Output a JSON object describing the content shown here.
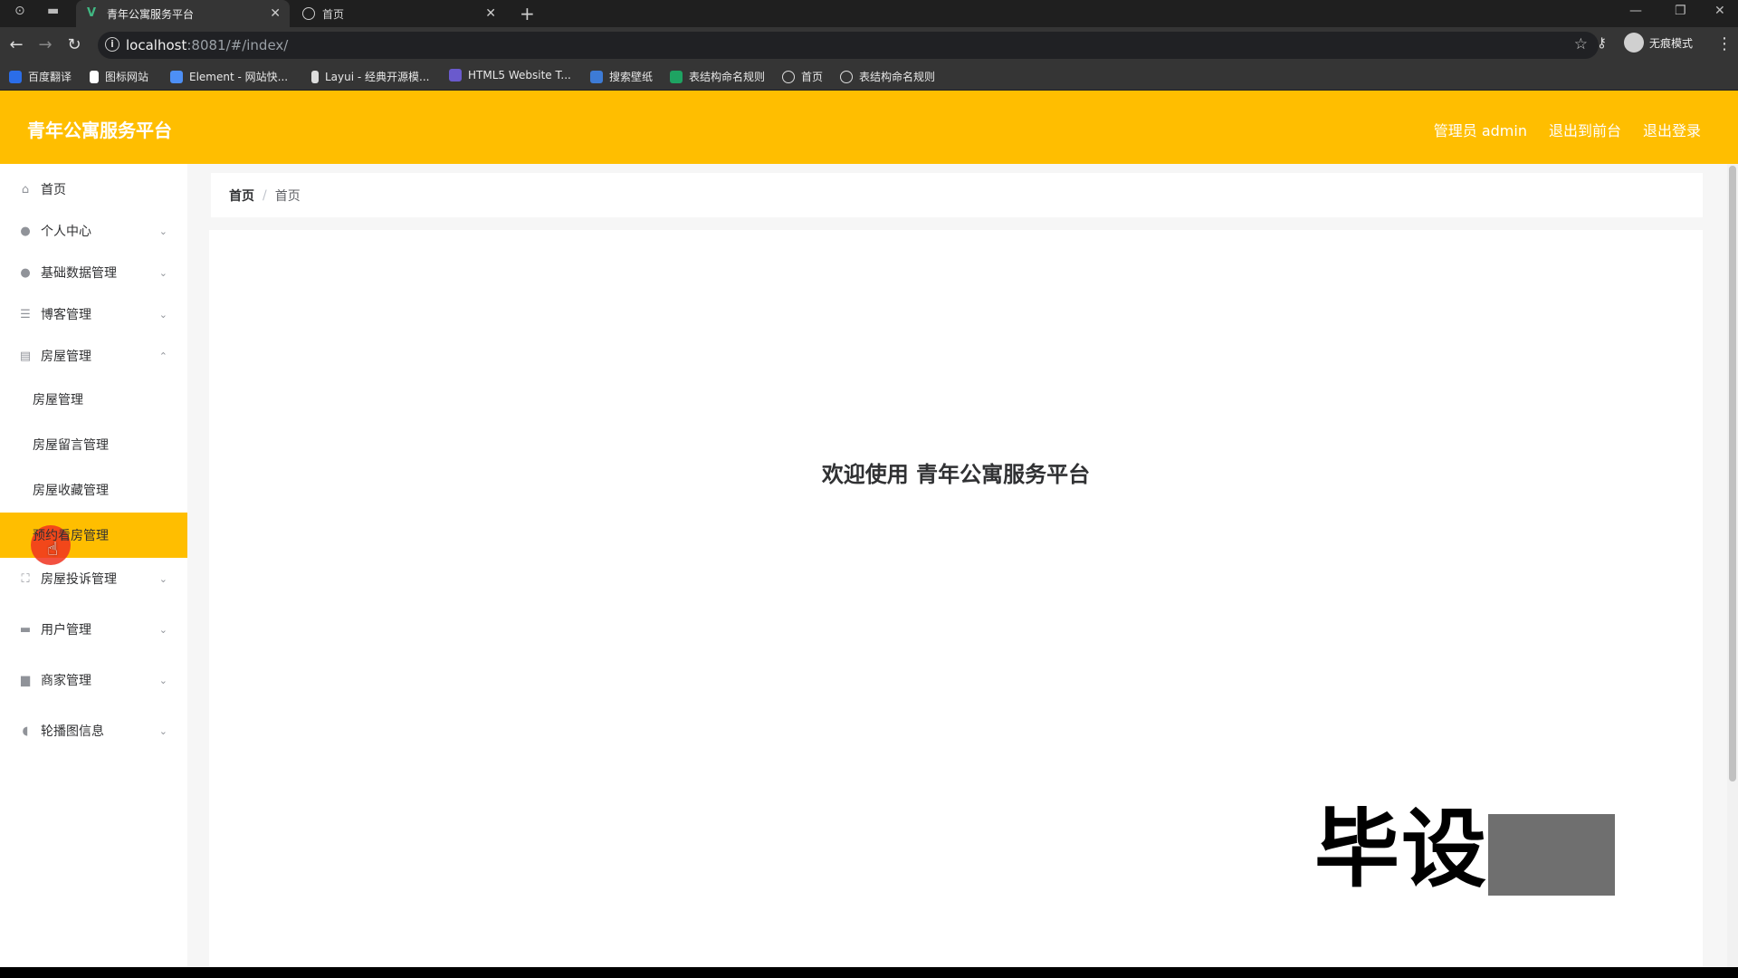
{
  "browser": {
    "tabs": [
      {
        "title": "青年公寓服务平台",
        "active": true
      },
      {
        "title": "首页",
        "active": false
      }
    ],
    "url_host": "localhost",
    "url_rest": ":8081/#/index/",
    "incognito_label": "无痕模式",
    "bookmarks": [
      {
        "label": "百度翻译",
        "color": "#2b6de8"
      },
      {
        "label": "图标网站",
        "color": "#ffffff"
      },
      {
        "label": "Element - 网站快...",
        "color": "#4d8ff5"
      },
      {
        "label": "Layui - 经典开源模...",
        "color": "#ffffff"
      },
      {
        "label": "HTML5 Website T...",
        "color": "#6a5acd"
      },
      {
        "label": "搜索壁纸",
        "color": "#3d7bd6"
      },
      {
        "label": "表结构命名规则",
        "color": "#1ea362"
      },
      {
        "label": "首页",
        "color": "#ffffff"
      },
      {
        "label": "表结构命名规则",
        "color": "#ffffff"
      }
    ]
  },
  "app": {
    "brand": "青年公寓服务平台",
    "top_links": {
      "admin": "管理员 admin",
      "back_to_front": "退出到前台",
      "logout": "退出登录"
    },
    "menu": {
      "home": "首页",
      "personal": "个人中心",
      "basic_data": "基础数据管理",
      "blog": "博客管理",
      "house": "房屋管理",
      "house_sub": [
        "房屋管理",
        "房屋留言管理",
        "房屋收藏管理",
        "预约看房管理"
      ],
      "complaint": "房屋投诉管理",
      "user": "用户管理",
      "merchant": "商家管理",
      "carousel": "轮播图信息"
    },
    "breadcrumb": [
      "首页",
      "首页"
    ],
    "welcome": "欢迎使用 青年公寓服务平台",
    "watermark": "毕设"
  },
  "colors": {
    "accent": "#ffbe00"
  }
}
